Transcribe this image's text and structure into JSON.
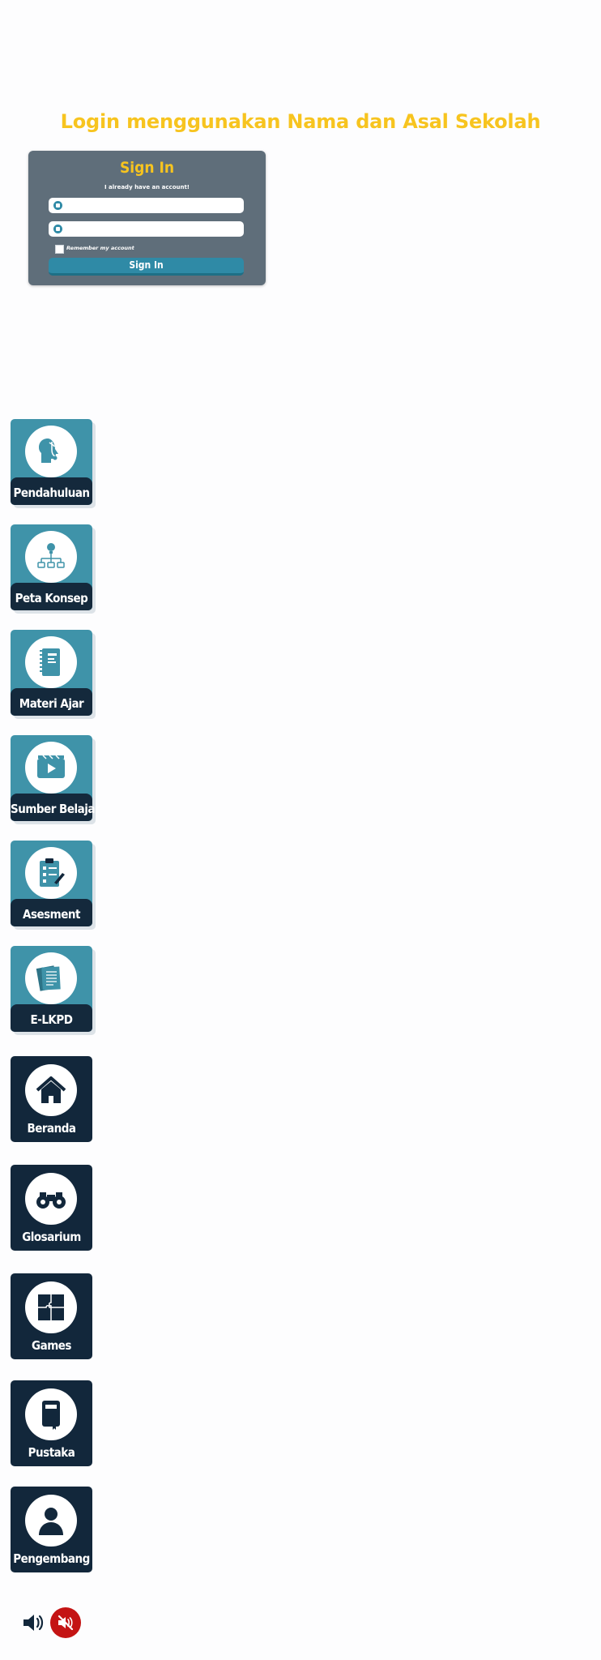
{
  "login": {
    "headline": "Login menggunakan Nama dan Asal Sekolah",
    "card_title": "Sign In",
    "card_subtitle": "I already have an account!",
    "name_placeholder": "",
    "school_placeholder": "",
    "remember_label": "Remember my account",
    "signin_button": "Sign In"
  },
  "menu": [
    {
      "label": "Pendahuluan",
      "icon": "head-stethoscope-icon",
      "style": "light"
    },
    {
      "label": "Peta Konsep",
      "icon": "lightbulb-hierarchy-icon",
      "style": "light"
    },
    {
      "label": "Materi Ajar",
      "icon": "notebook-icon",
      "style": "light"
    },
    {
      "label": "Sumber Belajar",
      "icon": "video-play-icon",
      "style": "light"
    },
    {
      "label": "Asesment",
      "icon": "clipboard-checklist-icon",
      "style": "light"
    },
    {
      "label": "E-LKPD",
      "icon": "document-stack-icon",
      "style": "light"
    },
    {
      "label": "Beranda",
      "icon": "home-icon",
      "style": "dark"
    },
    {
      "label": "Glosarium",
      "icon": "binoculars-icon",
      "style": "dark"
    },
    {
      "label": "Games",
      "icon": "puzzle-icon",
      "style": "dark"
    },
    {
      "label": "Pustaka",
      "icon": "book-icon",
      "style": "dark"
    },
    {
      "label": "Pengembang",
      "icon": "user-icon",
      "style": "dark"
    }
  ],
  "audio": {
    "on_icon": "speaker-on-icon",
    "off_icon": "speaker-mute-icon",
    "off_color": "#c41414"
  },
  "colors": {
    "accent_yellow": "#f7c41f",
    "card_gray": "#5f6e7a",
    "teal": "#3f93a9",
    "navy": "#12273b"
  }
}
